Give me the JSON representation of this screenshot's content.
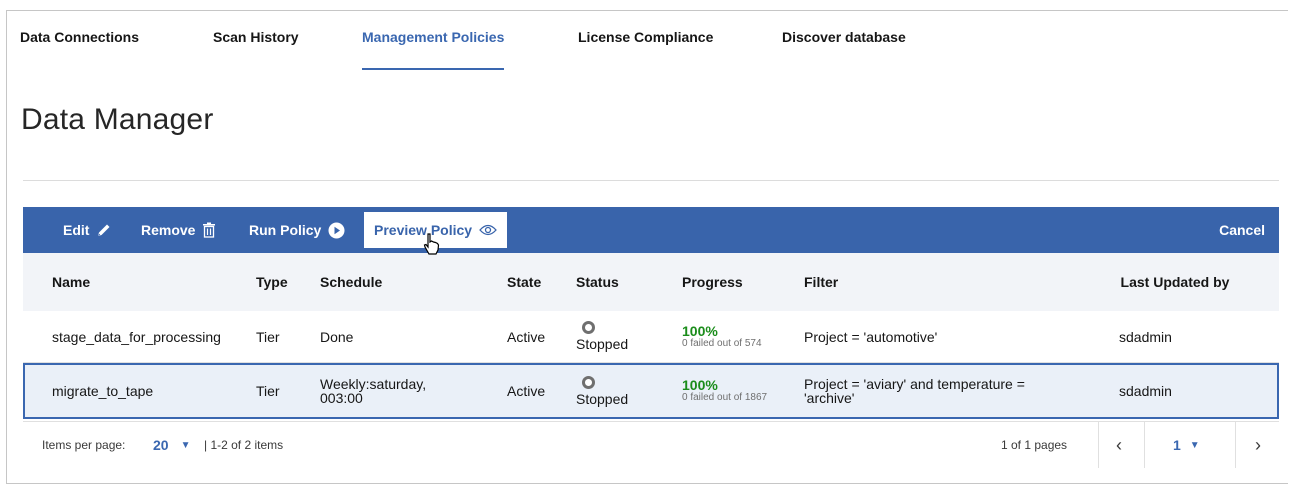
{
  "tabs": [
    {
      "label": "Data Connections"
    },
    {
      "label": "Scan History"
    },
    {
      "label": "Management Policies",
      "active": true
    },
    {
      "label": "License Compliance"
    },
    {
      "label": "Discover database"
    }
  ],
  "page": {
    "title": "Data Manager"
  },
  "toolbar": {
    "edit": "Edit",
    "remove": "Remove",
    "run_policy": "Run Policy",
    "preview_policy": "Preview Policy",
    "cancel": "Cancel",
    "icons": {
      "edit": "pencil-icon",
      "remove": "trash-icon",
      "run": "play-circle-icon",
      "preview": "eye-icon"
    }
  },
  "table": {
    "columns": {
      "name": "Name",
      "type": "Type",
      "schedule": "Schedule",
      "state": "State",
      "status": "Status",
      "progress": "Progress",
      "filter": "Filter",
      "last_updated_by": "Last Updated by"
    },
    "rows": [
      {
        "name": "stage_data_for_processing",
        "type": "Tier",
        "schedule": "Done",
        "state": "Active",
        "status": "Stopped",
        "progress_pct": "100%",
        "progress_detail": "0 failed out of 574",
        "filter": "Project = 'automotive'",
        "last_updated_by": "sdadmin",
        "selected": false
      },
      {
        "name": "migrate_to_tape",
        "type": "Tier",
        "schedule": "Weekly:saturday, 003:00",
        "state": "Active",
        "status": "Stopped",
        "progress_pct": "100%",
        "progress_detail": "0 failed out of 1867",
        "filter": "Project = 'aviary' and temperature = 'archive'",
        "last_updated_by": "sdadmin",
        "selected": true
      }
    ]
  },
  "pagination": {
    "items_per_page_label": "Items per page:",
    "items_per_page_value": "20",
    "range": "| 1-2 of 2 items",
    "pages_label": "1 of 1 pages",
    "current_page": "1"
  },
  "colors": {
    "accent": "#3964ab",
    "progress_green": "#1a8c1a",
    "header_bg": "#f2f4f8"
  }
}
